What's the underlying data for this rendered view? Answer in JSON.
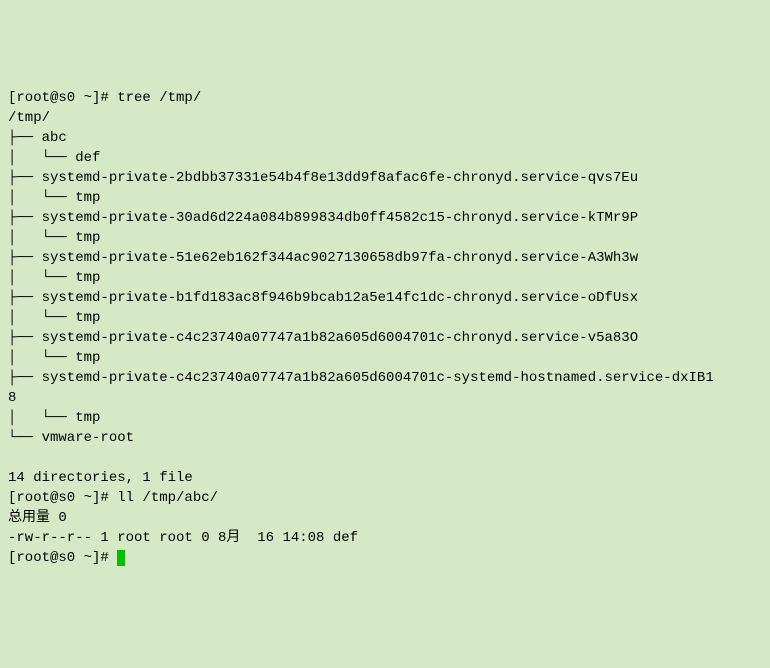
{
  "prompt1": "[root@s0 ~]# ",
  "cmd1": "tree /tmp/",
  "tree_root": "/tmp/",
  "tree_lines": [
    "├── abc",
    "│   └── def",
    "├── systemd-private-2bdbb37331e54b4f8e13dd9f8afac6fe-chronyd.service-qvs7Eu",
    "│   └── tmp",
    "├── systemd-private-30ad6d224a084b899834db0ff4582c15-chronyd.service-kTMr9P",
    "│   └── tmp",
    "├── systemd-private-51e62eb162f344ac9027130658db97fa-chronyd.service-A3Wh3w",
    "│   └── tmp",
    "├── systemd-private-b1fd183ac8f946b9bcab12a5e14fc1dc-chronyd.service-oDfUsx",
    "│   └── tmp",
    "├── systemd-private-c4c23740a07747a1b82a605d6004701c-chronyd.service-v5a83O",
    "│   └── tmp",
    "├── systemd-private-c4c23740a07747a1b82a605d6004701c-systemd-hostnamed.service-dxIB1",
    "8",
    "│   └── tmp",
    "└── vmware-root"
  ],
  "summary": "14 directories, 1 file",
  "prompt2": "[root@s0 ~]# ",
  "cmd2": "ll /tmp/abc/",
  "ll_total": "总用量 0",
  "ll_line": "-rw-r--r-- 1 root root 0 8月  16 14:08 def",
  "prompt3": "[root@s0 ~]# "
}
